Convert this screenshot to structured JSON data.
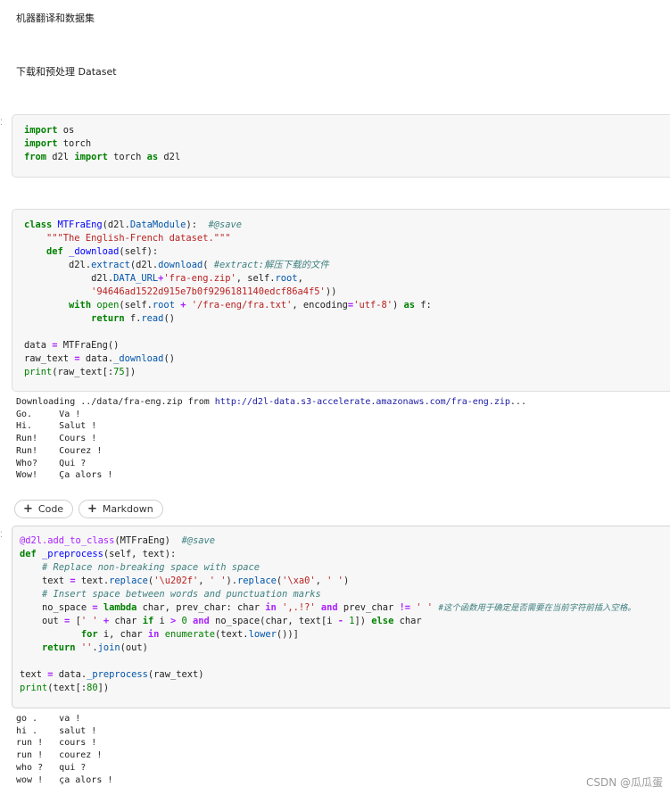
{
  "headings": {
    "title": "机器翻译和数据集",
    "subtitle": "下载和预处理 Dataset"
  },
  "toolbar": {
    "add_code_label": "Code",
    "add_markdown_label": "Markdown"
  },
  "outputs": {
    "download_prefix": "Downloading ../data/fra-eng.zip from ",
    "download_url": "http://d2l-data.s3-accelerate.amazonaws.com/fra-eng.zip",
    "download_suffix": "...",
    "raw_lines": [
      "Go.\tVa !",
      "Hi.\tSalut !",
      "Run!\tCours !",
      "Run!\tCourez !",
      "Who?\tQui ?",
      "Wow!\tÇa alors !"
    ],
    "processed_lines": [
      "go .\tva !",
      "hi .\tsalut !",
      "run !\tcours !",
      "run !\tcourez !",
      "who ?\tqui ?",
      "wow !\tça alors !"
    ]
  },
  "comments": {
    "save1": "#@save",
    "extract": "#extract:解压下载的文件",
    "save2": "#@save",
    "replace_nbsp": "# Replace non-breaking space with space",
    "insert_space": "# Insert space between words and punctuation marks",
    "no_space_note": "#这个函数用于确定是否需要在当前字符前插入空格。"
  },
  "strings": {
    "docstring": "\"\"\"The English-French dataset.\"\"\"",
    "zipname": "'fra-eng.zip'",
    "hash": "'94646ad1522d915e7b0f9296181140edcf86a4f5'",
    "fra_path": "'/fra-eng/fra.txt'",
    "utf8": "'utf-8'"
  },
  "watermark": "CSDN @瓜瓜蛋"
}
